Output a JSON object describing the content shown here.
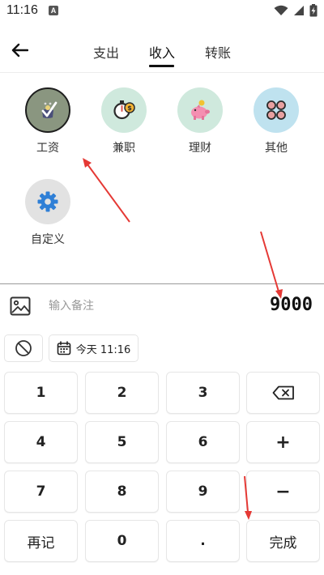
{
  "status_bar": {
    "time": "11:16",
    "badge": "A"
  },
  "header": {
    "tabs": [
      {
        "label": "支出",
        "active": false
      },
      {
        "label": "收入",
        "active": true
      },
      {
        "label": "转账",
        "active": false
      }
    ]
  },
  "categories": [
    {
      "label": "工资",
      "icon": "salary-icon",
      "selected": true,
      "color": "#8a9680"
    },
    {
      "label": "兼职",
      "icon": "stopwatch-coin-icon",
      "selected": false,
      "color": "#cfe9dd"
    },
    {
      "label": "理财",
      "icon": "piggy-bank-icon",
      "selected": false,
      "color": "#cfe9dd"
    },
    {
      "label": "其他",
      "icon": "clover-icon",
      "selected": false,
      "color": "#bfe2ef"
    },
    {
      "label": "自定义",
      "icon": "gear-icon",
      "selected": false,
      "color": "#e2e2e2"
    }
  ],
  "entry": {
    "note_placeholder": "输入备注",
    "amount": "9000"
  },
  "chips": {
    "date_label": "今天 11:16"
  },
  "keypad": {
    "rows": [
      [
        "1",
        "2",
        "3",
        "⌫"
      ],
      [
        "4",
        "5",
        "6",
        "+"
      ],
      [
        "7",
        "8",
        "9",
        "−"
      ],
      [
        "再记",
        "0",
        ".",
        "完成"
      ]
    ]
  },
  "colors": {
    "accent_arrow": "#e53935",
    "text": "#222222"
  }
}
